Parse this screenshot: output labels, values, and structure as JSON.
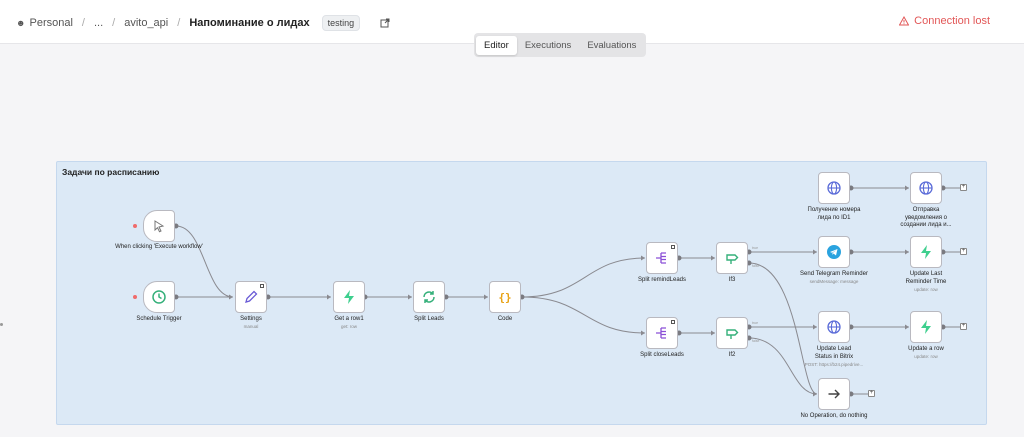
{
  "breadcrumb": {
    "personal": "Personal",
    "ellipsis": "...",
    "project": "avito_api",
    "workflow": "Напоминание о лидах",
    "tag": "testing"
  },
  "status": {
    "connection": "Connection lost"
  },
  "tabs": [
    {
      "label": "Editor",
      "active": true
    },
    {
      "label": "Executions",
      "active": false
    },
    {
      "label": "Evaluations",
      "active": false
    }
  ],
  "group": {
    "title": "Задачи по расписанию"
  },
  "nodes": {
    "manual": {
      "label": "When clicking 'Execute workflow'"
    },
    "schedule": {
      "label": "Schedule Trigger"
    },
    "settings": {
      "label": "Settings",
      "sub": "manual"
    },
    "getrow": {
      "label": "Get a row1",
      "sub": "get: row"
    },
    "splitleads": {
      "label": "Split Leads"
    },
    "code": {
      "label": "Code"
    },
    "splitremind": {
      "label": "Split remindLeads"
    },
    "splitclose": {
      "label": "Split closeLeads"
    },
    "if3": {
      "label": "If3"
    },
    "if2": {
      "label": "If2"
    },
    "getphone": {
      "label": "Получение номера лида по ID1"
    },
    "sendnotif": {
      "label": "Отправка уведомления о создании лида и..."
    },
    "telegram": {
      "label": "Send Telegram Reminder",
      "sub": "sendMessage: message"
    },
    "updreminder": {
      "label": "Update Last Reminder Time",
      "sub": "update: row"
    },
    "bitrix": {
      "label": "Update Lead Status in Bitrix",
      "sub": "POST: https://b24.pipedrive..."
    },
    "updrow": {
      "label": "Update a row",
      "sub": "update: row"
    },
    "noop": {
      "label": "No Operation, do nothing"
    }
  },
  "edge_labels": {
    "true": "true",
    "false": "false"
  }
}
